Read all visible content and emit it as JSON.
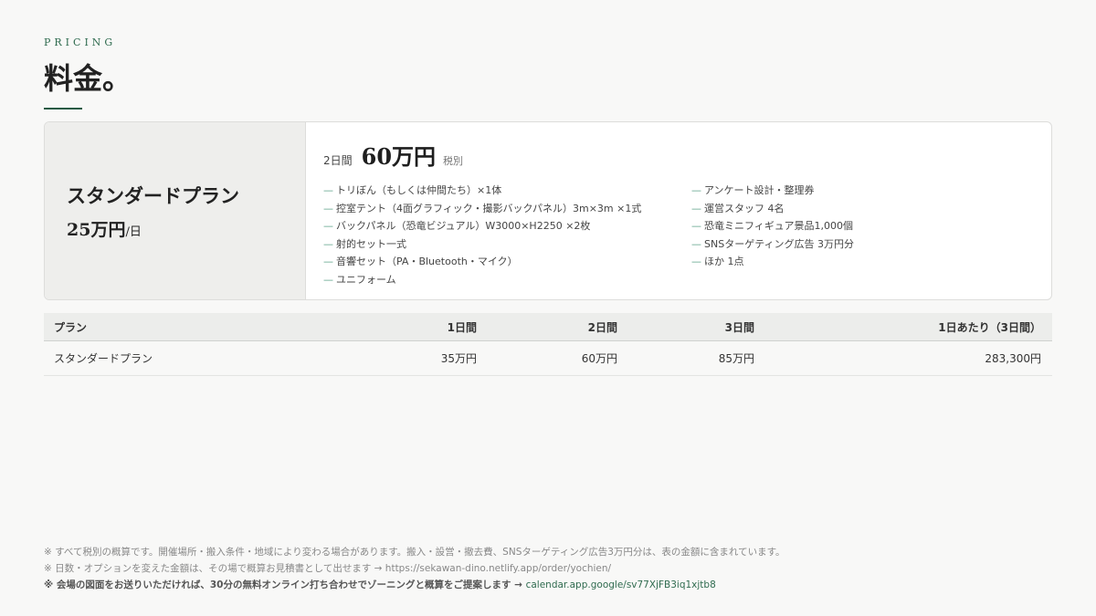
{
  "header": {
    "eyebrow": "PRICING",
    "title": "料金。"
  },
  "plan_card": {
    "name": "スタンダードプラン",
    "daily_price": "25万円",
    "daily_unit": "/日",
    "period": "2日間",
    "price": "60万円",
    "tax_note": "税別",
    "features_left": [
      "トリぼん（もしくは仲間たち）×1体",
      "控室テント（4面グラフィック・撮影バックパネル）3m×3m ×1式",
      "バックパネル（恐竜ビジュアル）W3000×H2250 ×2枚",
      "射的セット一式",
      "音響セット（PA・Bluetooth・マイク）",
      "ユニフォーム"
    ],
    "features_right": [
      "アンケート設計・整理券",
      "運営スタッフ 4名",
      "恐竜ミニフィギュア景品1,000個",
      "SNSターゲティング広告 3万円分",
      "ほか 1点"
    ],
    "dash": "—"
  },
  "table": {
    "headers": [
      "プラン",
      "1日間",
      "2日間",
      "3日間",
      "1日あたり（3日間）"
    ],
    "rows": [
      [
        "スタンダードプラン",
        "35万円",
        "60万円",
        "85万円",
        "283,300円"
      ]
    ]
  },
  "footnotes": {
    "note1": "※ すべて税別の概算です。開催場所・搬入条件・地域により変わる場合があります。搬入・設営・撤去費、SNSターゲティング広告3万円分は、表の金額に含まれています。",
    "note2": "※ 日数・オプションを変えた金額は、その場で概算お見積書として出せます → https://sekawan-dino.netlify.app/order/yochien/",
    "note3_text": "※ 会場の図面をお送りいただければ、30分の無料オンライン打ち合わせでゾーニングと概算をご提案します →",
    "note3_link": "calendar.app.google/sv77XjFB3iq1xjtb8"
  }
}
